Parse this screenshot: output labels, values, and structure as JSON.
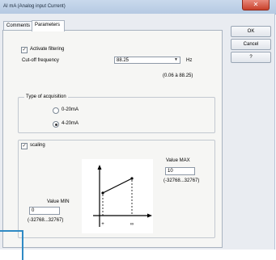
{
  "window": {
    "title": "AI mA (Analog input Current)",
    "close_glyph": "✕"
  },
  "tabs": [
    {
      "label": "Comments"
    },
    {
      "label": "Parameters"
    }
  ],
  "buttons": {
    "ok": "OK",
    "cancel": "Cancel",
    "help": "?"
  },
  "filtering": {
    "activate_label": "Activate filtering",
    "activate_checked": true,
    "cutoff_label": "Cut-off frequency",
    "cutoff_value": "88.25",
    "cutoff_unit": "Hz",
    "cutoff_range": "(0.06 à 88.25)"
  },
  "acquisition": {
    "group_label": "Type of acquisition",
    "options": [
      {
        "label": "0-20mA",
        "selected": false
      },
      {
        "label": "4-20mA",
        "selected": true
      }
    ]
  },
  "scaling": {
    "label": "scaling",
    "checked": true,
    "max_label": "Value MAX",
    "max_value": "10",
    "max_range": "(-32768...32767)",
    "min_label": "Value MIN",
    "min_value": "0",
    "min_range": "(-32768...32767)",
    "graph_x_labels": [
      "+",
      "∞"
    ]
  }
}
